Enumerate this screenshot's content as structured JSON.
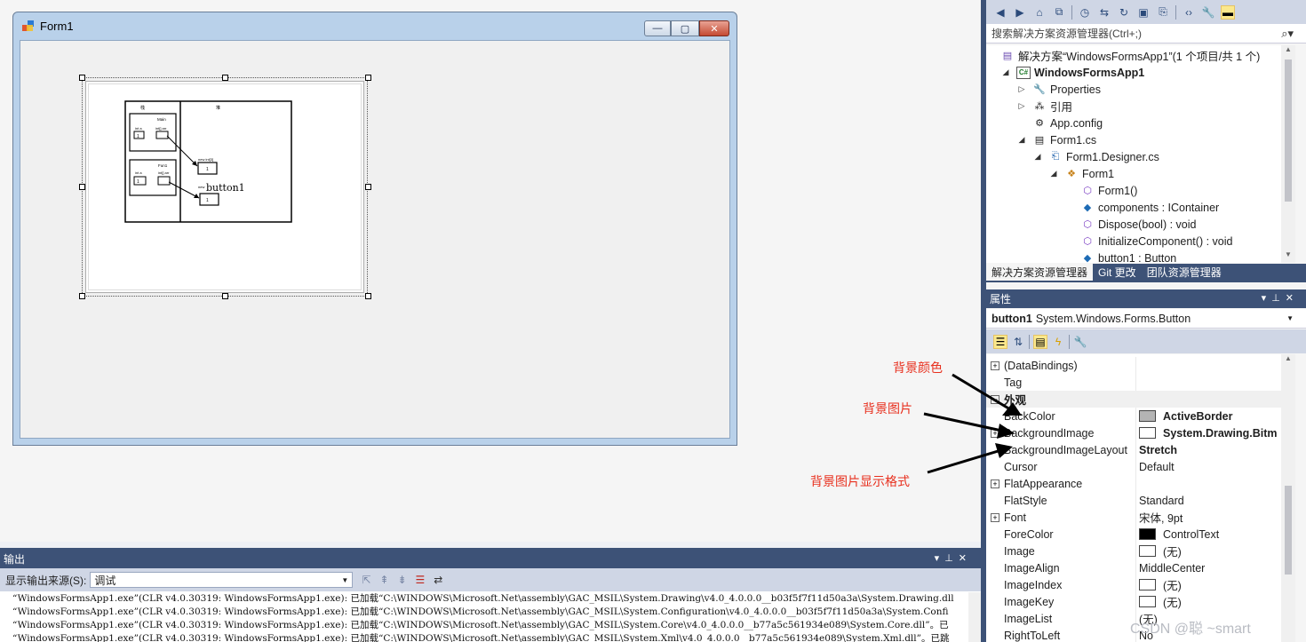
{
  "form": {
    "title": "Form1",
    "controls": {
      "minimize": "—",
      "maximize": "▢",
      "close": "✕"
    }
  },
  "button": {
    "label": "button1",
    "diagram": {
      "stack_label": "栈",
      "heap_label": "堆",
      "main_label": "Main",
      "main_var1": "int a",
      "main_var2": "int[] arr",
      "fun_label": "Fun1",
      "fun_var1": "int a",
      "fun_var2": "int[] arr",
      "heap_new1": "new int[3]",
      "heap_new2": "new"
    }
  },
  "solution_explorer": {
    "search_placeholder": "搜索解决方案资源管理器(Ctrl+;)",
    "items": [
      {
        "label": "解决方案“WindowsFormsApp1”(1 个项目/共 1 个)",
        "icon": "solution-icon"
      },
      {
        "label": "WindowsFormsApp1",
        "icon": "csharp-project-icon"
      },
      {
        "label": "Properties",
        "icon": "wrench-icon"
      },
      {
        "label": "引用",
        "icon": "references-icon"
      },
      {
        "label": "App.config",
        "icon": "config-file-icon"
      },
      {
        "label": "Form1.cs",
        "icon": "form-file-icon"
      },
      {
        "label": "Form1.Designer.cs",
        "icon": "csharp-file-icon"
      },
      {
        "label": "Form1",
        "icon": "class-icon"
      },
      {
        "label": "Form1()",
        "icon": "method-icon"
      },
      {
        "label": "components : IContainer",
        "icon": "field-icon"
      },
      {
        "label": "Dispose(bool) : void",
        "icon": "method-icon"
      },
      {
        "label": "InitializeComponent() : void",
        "icon": "method-icon"
      },
      {
        "label": "button1 : Button",
        "icon": "field-icon"
      }
    ],
    "tabs": [
      "解决方案资源管理器",
      "Git 更改",
      "团队资源管理器"
    ]
  },
  "properties": {
    "title": "属性",
    "object_name": "button1",
    "object_type": "System.Windows.Forms.Button",
    "rows": [
      {
        "name": "(DataBindings)",
        "value": "",
        "expand": "+"
      },
      {
        "name": "Tag",
        "value": ""
      },
      {
        "name": "外观",
        "value": "",
        "category": true
      },
      {
        "name": "BackColor",
        "value": "ActiveBorder",
        "swatch": "#b4b4b4",
        "bold": true
      },
      {
        "name": "BackgroundImage",
        "value": "System.Drawing.Bitm",
        "swatch": "#ffffff",
        "bold": true,
        "expand": "+"
      },
      {
        "name": "BackgroundImageLayout",
        "value": "Stretch",
        "bold": true
      },
      {
        "name": "Cursor",
        "value": "Default"
      },
      {
        "name": "FlatAppearance",
        "value": "",
        "expand": "+"
      },
      {
        "name": "FlatStyle",
        "value": "Standard"
      },
      {
        "name": "Font",
        "value": "宋体, 9pt",
        "expand": "+"
      },
      {
        "name": "ForeColor",
        "value": "ControlText",
        "swatch": "#000000"
      },
      {
        "name": "Image",
        "value": "(无)",
        "swatch": "#ffffff"
      },
      {
        "name": "ImageAlign",
        "value": "MiddleCenter"
      },
      {
        "name": "ImageIndex",
        "value": "(无)",
        "swatch": "#ffffff"
      },
      {
        "name": "ImageKey",
        "value": "(无)",
        "swatch": "#ffffff"
      },
      {
        "name": "ImageList",
        "value": "(无)"
      },
      {
        "name": "RightToLeft",
        "value": "No"
      }
    ]
  },
  "output": {
    "title": "输出",
    "source_label": "显示输出来源(S):",
    "source_value": "调试",
    "lines": [
      "“WindowsFormsApp1.exe”(CLR v4.0.30319: WindowsFormsApp1.exe): 已加载“C:\\WINDOWS\\Microsoft.Net\\assembly\\GAC_MSIL\\System.Drawing\\v4.0_4.0.0.0__b03f5f7f11d50a3a\\System.Drawing.dll",
      "“WindowsFormsApp1.exe”(CLR v4.0.30319: WindowsFormsApp1.exe): 已加载“C:\\WINDOWS\\Microsoft.Net\\assembly\\GAC_MSIL\\System.Configuration\\v4.0_4.0.0.0__b03f5f7f11d50a3a\\System.Confi",
      "“WindowsFormsApp1.exe”(CLR v4.0.30319: WindowsFormsApp1.exe): 已加载“C:\\WINDOWS\\Microsoft.Net\\assembly\\GAC_MSIL\\System.Core\\v4.0_4.0.0.0__b77a5c561934e089\\System.Core.dll”。已",
      "“WindowsFormsApp1.exe”(CLR v4.0.30319: WindowsFormsApp1.exe): 已加载“C:\\WINDOWS\\Microsoft.Net\\assembly\\GAC_MSIL\\System.Xml\\v4.0_4.0.0.0__b77a5c561934e089\\System.Xml.dll”。已跳"
    ]
  },
  "annotations": {
    "back_color": "背景颜色",
    "back_image": "背景图片",
    "image_layout": "背景图片显示格式",
    "color": "#e8301e"
  },
  "watermark": "CSDN @聪      ~smart"
}
